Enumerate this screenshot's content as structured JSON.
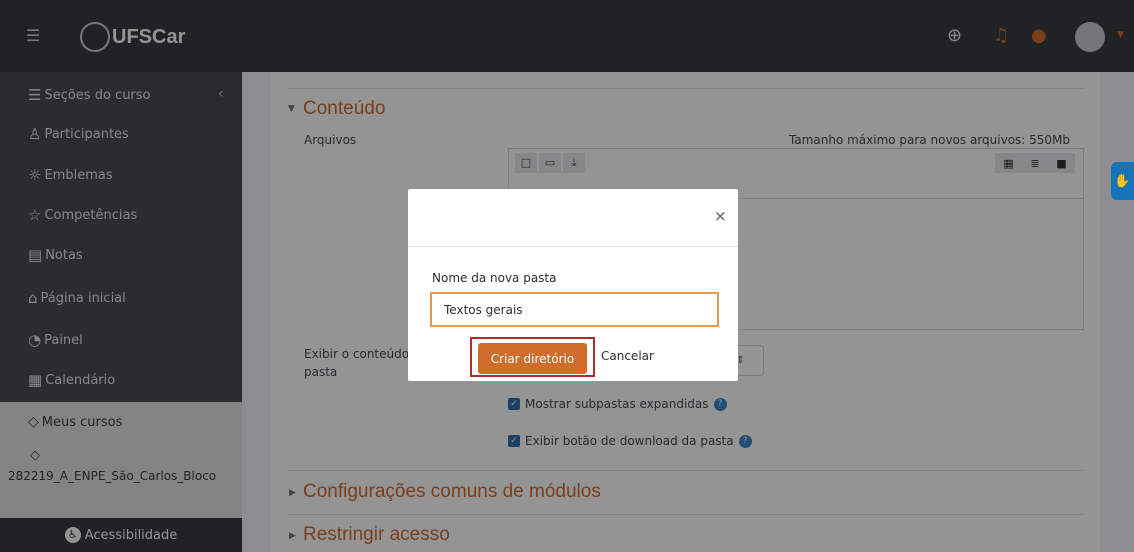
{
  "topbar": {
    "menu_icon": "hamburger-icon",
    "brand": "UFSCar",
    "icons": [
      "globe-icon",
      "bell-icon",
      "chat-icon",
      "avatar",
      "caret-down-icon"
    ],
    "accent": "#d06d2b"
  },
  "sidebar": {
    "items": [
      {
        "label": "Seções do curso",
        "icon": "list-icon"
      },
      {
        "label": "Participantes",
        "icon": "users-icon"
      },
      {
        "label": "Emblemas",
        "icon": "badge-icon"
      },
      {
        "label": "Competências",
        "icon": "star-icon"
      },
      {
        "label": "Notas",
        "icon": "grades-icon"
      },
      {
        "label": "Página inicial",
        "icon": "home-icon"
      },
      {
        "label": "Painel",
        "icon": "dashboard-icon"
      },
      {
        "label": "Calendário",
        "icon": "calendar-icon"
      }
    ],
    "my_courses": {
      "label": "Meus cursos",
      "icon": "graduation-cap-icon"
    },
    "course": {
      "name": "282219_A_ENPE_São_Carlos_Bloco",
      "icon": "graduation-cap-icon"
    },
    "accessibility": "Acessibilidade"
  },
  "main": {
    "section_content": "Conteúdo",
    "files_label": "Arquivos",
    "max_size": "Tamanho máximo para novos arquivos: 550Mb",
    "display_label_line1": "Exibir o conteúdo",
    "display_label_line2": "pasta",
    "checkbox_expand": "Mostrar subpastas expandidas",
    "checkbox_download": "Exibir botão de download da pasta",
    "section_common": "Configurações comuns de módulos",
    "section_restrict": "Restringir acesso"
  },
  "modal": {
    "label": "Nome da nova pasta",
    "input_value": "Textos gerais",
    "create_button": "Criar diretório",
    "cancel_button": "Cancelar",
    "close_icon": "close-icon"
  },
  "colors": {
    "brand_orange": "#d06d2b",
    "navbar": "#383b3f",
    "sidebar": "#4a4d50",
    "highlight_border": "#b22a2a"
  }
}
